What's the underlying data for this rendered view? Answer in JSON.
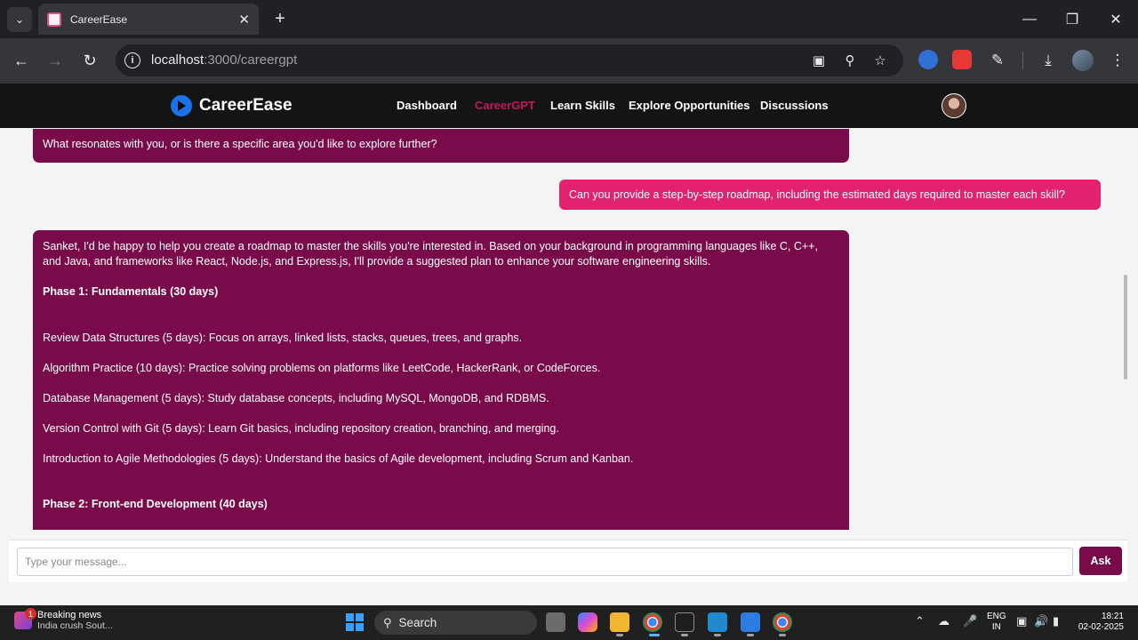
{
  "browser": {
    "tab_title": "CareerEase",
    "url_host": "localhost",
    "url_path": ":3000/careergpt"
  },
  "app": {
    "brand": "CareerEase",
    "nav": [
      {
        "label": "Dashboard",
        "active": false
      },
      {
        "label": "CareerGPT",
        "active": true
      },
      {
        "label": "Learn Skills",
        "active": false
      },
      {
        "label": "Explore Opportunities",
        "active": false
      },
      {
        "label": "Discussions",
        "active": false
      }
    ]
  },
  "chat": {
    "prev_bot_tail": "What resonates with you, or is there a specific area you'd like to explore further?",
    "user_message": "Can you provide a step-by-step roadmap, including the estimated days required to master each skill?",
    "bot_reply": {
      "intro": "Sanket, I'd be happy to help you create a roadmap to master the skills you're interested in. Based on your background in programming languages like C, C++, and Java, and frameworks like React, Node.js, and Express.js, I'll provide a suggested plan to enhance your software engineering skills.",
      "phase1_title": "Phase 1: Fundamentals (30 days)",
      "phase1_items": [
        "Review Data Structures (5 days): Focus on arrays, linked lists, stacks, queues, trees, and graphs.",
        "Algorithm Practice (10 days): Practice solving problems on platforms like LeetCode, HackerRank, or CodeForces.",
        "Database Management (5 days): Study database concepts, including MySQL, MongoDB, and RDBMS.",
        "Version Control with Git (5 days): Learn Git basics, including repository creation, branching, and merging.",
        "Introduction to Agile Methodologies (5 days): Understand the basics of Agile development, including Scrum and Kanban."
      ],
      "phase2_title": "Phase 2: Front-end Development (40 days)"
    },
    "input_placeholder": "Type your message...",
    "ask_label": "Ask"
  },
  "taskbar": {
    "news_title": "Breaking news",
    "news_sub": "India crush Sout...",
    "news_badge": "1",
    "search_label": "Search",
    "lang_top": "ENG",
    "lang_bottom": "IN",
    "time": "18:21",
    "date": "02-02-2025"
  }
}
